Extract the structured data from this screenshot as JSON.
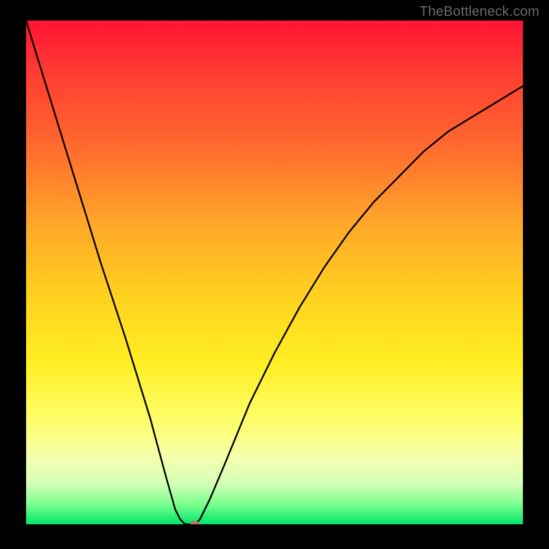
{
  "watermark": "TheBottleneck.com",
  "chart_data": {
    "type": "line",
    "title": "",
    "xlabel": "",
    "ylabel": "",
    "xlim": [
      0,
      100
    ],
    "ylim": [
      0,
      100
    ],
    "x": [
      0,
      5,
      10,
      15,
      20,
      25,
      28,
      30,
      31,
      32,
      33,
      34,
      35,
      37,
      40,
      45,
      50,
      55,
      60,
      65,
      70,
      75,
      80,
      85,
      90,
      95,
      100
    ],
    "y": [
      100,
      84,
      68,
      52,
      37,
      21,
      10,
      3,
      1,
      0,
      0,
      0,
      1,
      5,
      12,
      24,
      34,
      43,
      51,
      58,
      64,
      69,
      74,
      78,
      81,
      84,
      87
    ],
    "marker": {
      "x": 34,
      "y": 0
    },
    "background_gradient": {
      "top_color": "#ff1433",
      "bottom_color": "#00e56a"
    }
  }
}
